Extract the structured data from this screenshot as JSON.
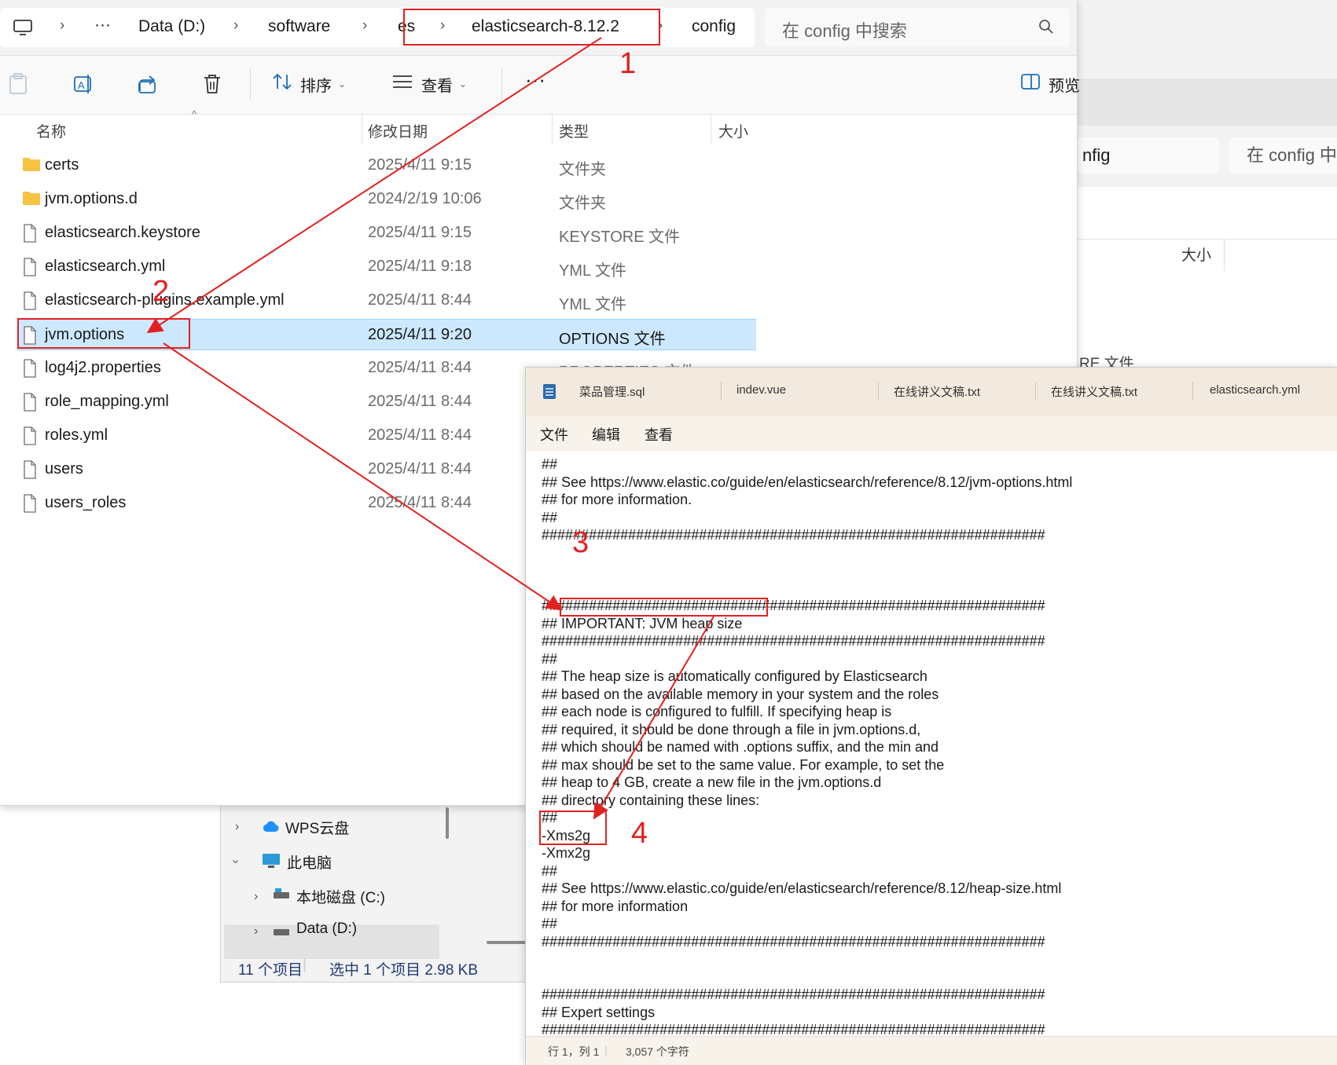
{
  "background_window": {
    "crumb": "nfig",
    "search_placeholder": "在 config 中搜",
    "size_col": "大小",
    "row_type": "RE 文件"
  },
  "nav_pane": {
    "items": [
      {
        "label": "WPS云盘",
        "icon": "cloud-icon"
      },
      {
        "label": "此电脑",
        "icon": "computer-icon"
      },
      {
        "label": "本地磁盘 (C:)",
        "icon": "drive-icon"
      },
      {
        "label": "Data (D:)",
        "icon": "drive-icon"
      }
    ]
  },
  "status_bar": {
    "count": "11 个项目",
    "selection": "选中 1 个项目  2.98 KB"
  },
  "address_bar": {
    "ellipsis": "···",
    "crumbs": [
      "Data (D:)",
      "software",
      "es",
      "elasticsearch-8.12.2",
      "config"
    ],
    "search_placeholder": "在 config 中搜索"
  },
  "toolbar": {
    "sort_label": "排序",
    "view_label": "查看",
    "more_label": "···",
    "preview_label": "预览"
  },
  "columns": {
    "name": "名称",
    "date": "修改日期",
    "type": "类型",
    "size": "大小"
  },
  "files": [
    {
      "name": "certs",
      "date": "2025/4/11 9:15",
      "type": "文件夹",
      "kind": "folder"
    },
    {
      "name": "jvm.options.d",
      "date": "2024/2/19 10:06",
      "type": "文件夹",
      "kind": "folder"
    },
    {
      "name": "elasticsearch.keystore",
      "date": "2025/4/11 9:15",
      "type": "KEYSTORE 文件",
      "kind": "file"
    },
    {
      "name": "elasticsearch.yml",
      "date": "2025/4/11 9:18",
      "type": "YML 文件",
      "kind": "file"
    },
    {
      "name": "elasticsearch-plugins.example.yml",
      "date": "2025/4/11 8:44",
      "type": "YML 文件",
      "kind": "file"
    },
    {
      "name": "jvm.options",
      "date": "2025/4/11 9:20",
      "type": "OPTIONS 文件",
      "kind": "file",
      "selected": true
    },
    {
      "name": "log4j2.properties",
      "date": "2025/4/11 8:44",
      "type": "PROPERTIES 文件",
      "kind": "file"
    },
    {
      "name": "role_mapping.yml",
      "date": "2025/4/11 8:44",
      "type": "",
      "kind": "file"
    },
    {
      "name": "roles.yml",
      "date": "2025/4/11 8:44",
      "type": "",
      "kind": "file"
    },
    {
      "name": "users",
      "date": "2025/4/11 8:44",
      "type": "",
      "kind": "file"
    },
    {
      "name": "users_roles",
      "date": "2025/4/11 8:44",
      "type": "",
      "kind": "file"
    }
  ],
  "notepad": {
    "tabs": [
      "菜品管理.sql",
      "indev.vue",
      "在线讲义文稿.txt",
      "在线讲义文稿.txt",
      "elasticsearch.yml"
    ],
    "menu": [
      "文件",
      "编辑",
      "查看"
    ],
    "lines": [
      "##",
      "## See https://www.elastic.co/guide/en/elasticsearch/reference/8.12/jvm-options.html",
      "## for more information.",
      "##",
      "################################################################",
      "",
      "",
      "",
      "################################################################",
      "## IMPORTANT: JVM heap size",
      "################################################################",
      "##",
      "## The heap size is automatically configured by Elasticsearch",
      "## based on the available memory in your system and the roles",
      "## each node is configured to fulfill. If specifying heap is",
      "## required, it should be done through a file in jvm.options.d,",
      "## which should be named with .options suffix, and the min and",
      "## max should be set to the same value. For example, to set the",
      "## heap to 4 GB, create a new file in the jvm.options.d",
      "## directory containing these lines:",
      "##",
      "-Xms2g",
      "-Xmx2g",
      "##",
      "## See https://www.elastic.co/guide/en/elasticsearch/reference/8.12/heap-size.html",
      "## for more information",
      "##",
      "################################################################",
      "",
      "",
      "################################################################",
      "## Expert settings",
      "################################################################",
      "##"
    ],
    "status_position": "行 1，列 1",
    "status_chars": "3,057 个字符"
  },
  "annotations": {
    "labels": [
      "1",
      "2",
      "3",
      "4"
    ],
    "color": "#e32020"
  },
  "colors": {
    "selection": "#cce8ff",
    "annotation_red": "#e32020",
    "folder_yellow": "#f5c242",
    "notepad_tab_bg": "#f2eadf"
  }
}
